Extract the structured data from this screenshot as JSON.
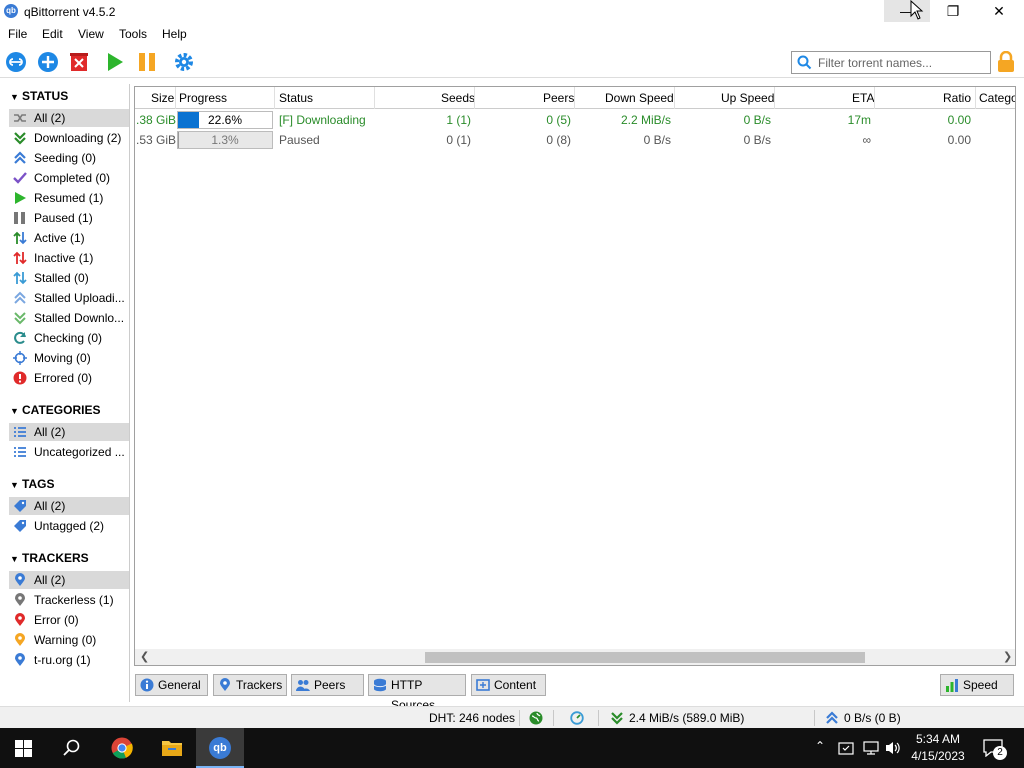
{
  "window": {
    "title": "qBittorrent v4.5.2",
    "app_icon_text": "qb"
  },
  "menu": [
    "File",
    "Edit",
    "View",
    "Tools",
    "Help"
  ],
  "search": {
    "placeholder": "Filter torrent names..."
  },
  "sidebar": {
    "status_title": "STATUS",
    "status_items": [
      "All (2)",
      "Downloading (2)",
      "Seeding (0)",
      "Completed (0)",
      "Resumed (1)",
      "Paused (1)",
      "Active (1)",
      "Inactive (1)",
      "Stalled (0)",
      "Stalled Uploadi...",
      "Stalled Downlo...",
      "Checking (0)",
      "Moving (0)",
      "Errored (0)"
    ],
    "categories_title": "CATEGORIES",
    "categories_items": [
      "All (2)",
      "Uncategorized ..."
    ],
    "tags_title": "TAGS",
    "tags_items": [
      "All (2)",
      "Untagged (2)"
    ],
    "trackers_title": "TRACKERS",
    "trackers_items": [
      "All (2)",
      "Trackerless (1)",
      "Error (0)",
      "Warning (0)",
      "t-ru.org (1)"
    ]
  },
  "table": {
    "headers": [
      "Size",
      "Progress",
      "Status",
      "Seeds",
      "Peers",
      "Down Speed",
      "Up Speed",
      "ETA",
      "Ratio",
      "Catego"
    ],
    "rows": [
      {
        "size": ".38 GiB",
        "progress_text": "22.6%",
        "progress": 0.226,
        "status": "[F] Downloading",
        "seeds": "1 (1)",
        "peers": "0 (5)",
        "down": "2.2 MiB/s",
        "up": "0 B/s",
        "eta": "17m",
        "ratio": "0.00"
      },
      {
        "size": ".53 GiB",
        "progress_text": "1.3%",
        "progress": 0.013,
        "status": "Paused",
        "seeds": "0 (1)",
        "peers": "0 (8)",
        "down": "0 B/s",
        "up": "0 B/s",
        "eta": "∞",
        "ratio": "0.00"
      }
    ]
  },
  "bottom_tabs": [
    "General",
    "Trackers",
    "Peers",
    "HTTP Sources",
    "Content"
  ],
  "speed_button": "Speed",
  "statusbar": {
    "dht": "DHT: 246 nodes",
    "down": "2.4 MiB/s (589.0 MiB)",
    "up": "0 B/s (0 B)"
  },
  "taskbar": {
    "time": "5:34 AM",
    "date": "4/15/2023",
    "notif_count": "2"
  },
  "colors": {
    "accent": "#0a72d1",
    "downloading_green": "#2a8c2a",
    "paused_orange": "#f5a623",
    "play_green": "#2db52d"
  }
}
